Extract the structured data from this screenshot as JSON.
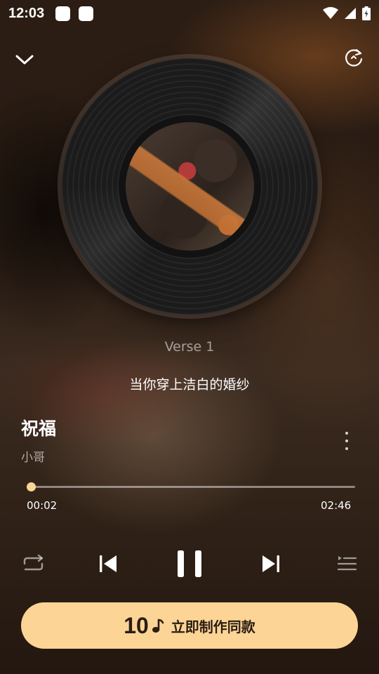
{
  "status_bar": {
    "time": "12:03"
  },
  "player": {
    "section_label": "Verse 1",
    "lyric_line": "当你穿上洁白的婚纱",
    "song_title": "祝福",
    "artist": "小哥",
    "progress": {
      "current": "00:02",
      "total": "02:46",
      "fraction": 0.012
    }
  },
  "cta": {
    "count": "10",
    "label": "立即制作同款",
    "color": "#fcd596"
  },
  "icons": {
    "collapse": "chevron-down-icon",
    "refresh": "refresh-icon",
    "more": "more-vertical-icon",
    "repeat": "repeat-icon",
    "previous": "skip-previous-icon",
    "pause": "pause-icon",
    "next": "skip-next-icon",
    "queue": "playlist-icon",
    "note": "music-note-icon"
  }
}
